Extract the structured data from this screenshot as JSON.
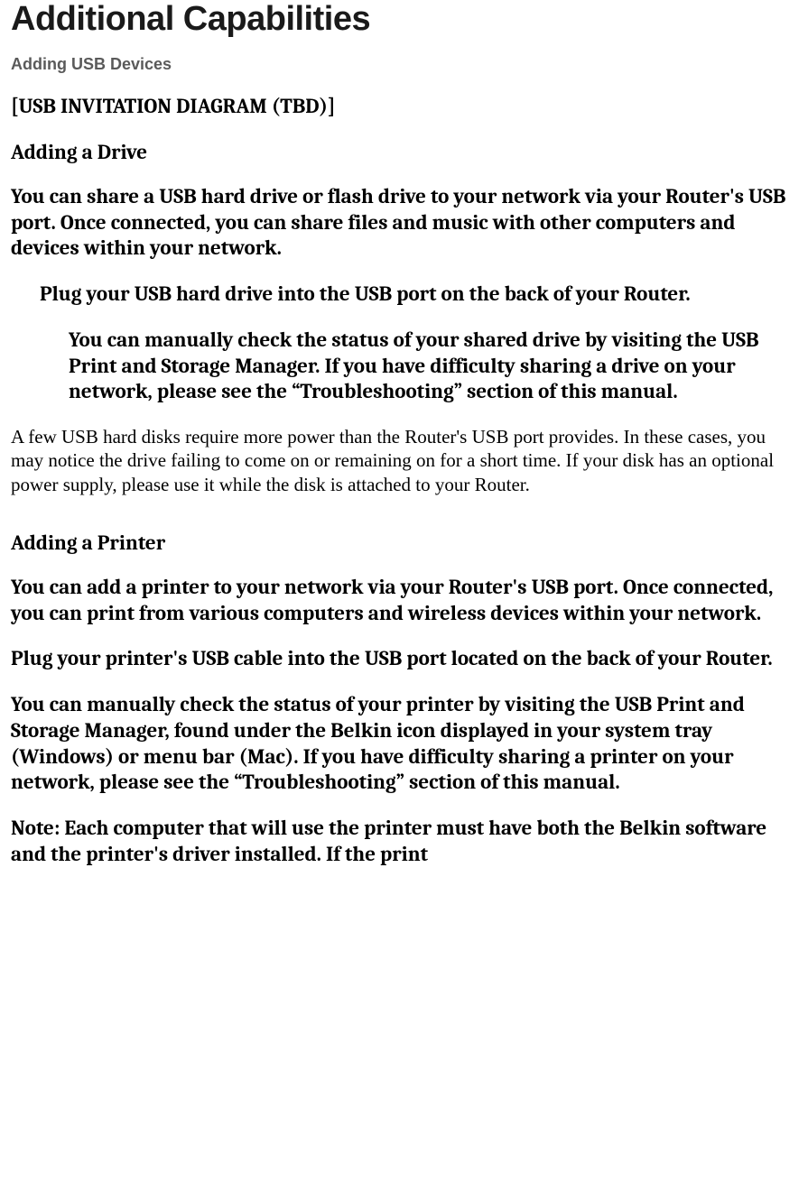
{
  "title": "Additional Capabilities",
  "subhead_usb": "Adding USB Devices",
  "diagram_placeholder": "[USB INVITATION DIAGRAM (TBD)]",
  "drive": {
    "heading": "Adding a Drive",
    "intro": "You can share a USB hard drive or flash drive to your network via your Router's USB port. Once connected, you can share files and music with other computers and devices within your network.",
    "step_plug": "Plug your USB hard drive into the USB port on the back of your Router.",
    "step_check": "You can manually check the status of your shared drive by visiting the USB Print and Storage Manager. If you have difficulty sharing a drive on your network, please see the “Troubleshooting” section of this manual.",
    "power_note": "A few USB hard disks require more power than the Router's USB port provides. In these cases, you may notice the drive failing to come on or remaining on for a short time. If your disk has an optional power supply, please use it while the disk is attached to your Router."
  },
  "printer": {
    "heading": "Adding a Printer",
    "intro": "You can add a printer to your network via your Router's USB port. Once connected, you can print from various computers and wireless devices within your network.",
    "step_plug": "Plug your printer's USB cable into the USB port located on the back of your Router.",
    "step_check": "You can manually check the status of your printer by visiting the USB Print and Storage Manager, found under the Belkin icon displayed in your system tray (Windows) or menu bar (Mac). If you have difficulty sharing a printer on your network, please see the “Troubleshooting” section of this manual.",
    "note": "Note: Each computer that will use the printer must have both the Belkin software and the printer's driver installed. If the print"
  }
}
